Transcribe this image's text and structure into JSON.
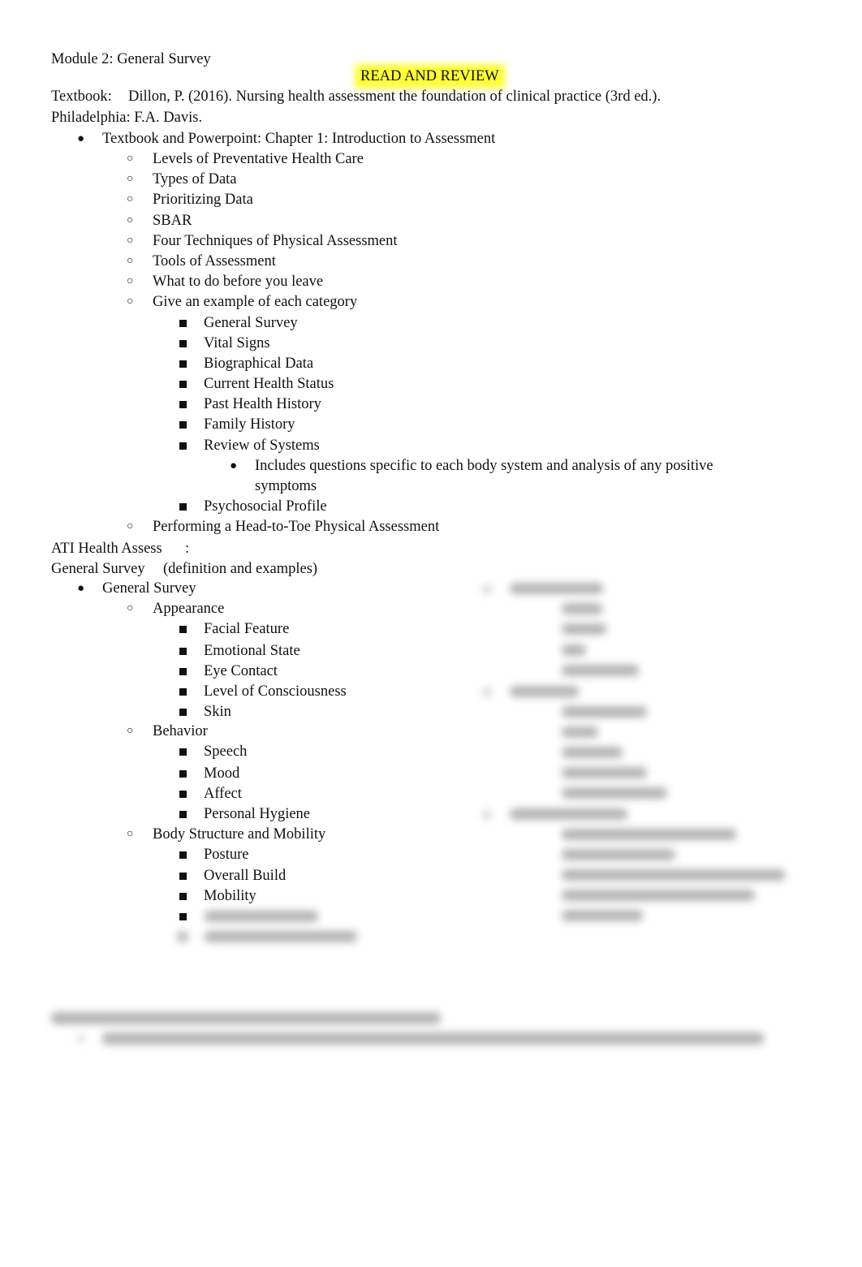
{
  "document": {
    "module_title": "Module 2: General Survey",
    "highlight_banner": "READ AND REVIEW",
    "highlight_color": "#ffff3a",
    "textbook_label": "Textbook:",
    "textbook_citation": "Dillon, P. (2016). Nursing health assessment the foundation of clinical practice (3rd ed.).",
    "textbook_publisher": "Philadelphia: F.A. Davis.",
    "chapter_item": "Textbook and Powerpoint: Chapter 1: Introduction to Assessment",
    "chapter_subitems": [
      "Levels of Preventative Health Care",
      "Types of Data",
      "Prioritizing Data",
      "SBAR",
      "Four Techniques of Physical Assessment",
      "Tools of Assessment",
      "What to do before you leave",
      "Give an example of each category"
    ],
    "category_examples": [
      "General Survey",
      "Vital Signs",
      "Biographical Data",
      "Current Health Status",
      "Past Health History",
      "Family History",
      "Review of Systems"
    ],
    "review_of_systems_note_line1": "Includes questions specific to each body system and analysis of any positive",
    "review_of_systems_note_line2": "symptoms",
    "psychosocial": "Psychosocial Profile",
    "head_to_toe": "Performing a Head-to-Toe Physical Assessment",
    "ati_label": "ATI Health Assess",
    "ati_colon": ":",
    "gs_label": "General Survey",
    "gs_desc": "(definition and examples)",
    "gs_item": "General Survey",
    "appearance": {
      "label": "Appearance",
      "items": [
        "Facial Feature",
        "Emotional State",
        "Eye Contact",
        "Level of Consciousness",
        "Skin"
      ]
    },
    "behavior": {
      "label": "Behavior",
      "items": [
        "Speech",
        "Mood",
        "Affect",
        "Personal Hygiene"
      ]
    },
    "body_structure": {
      "label": "Body Structure and Mobility",
      "items": [
        "Posture",
        "Overall Build",
        "Mobility"
      ]
    },
    "obscured_content_note": "blurred / unreadable"
  }
}
